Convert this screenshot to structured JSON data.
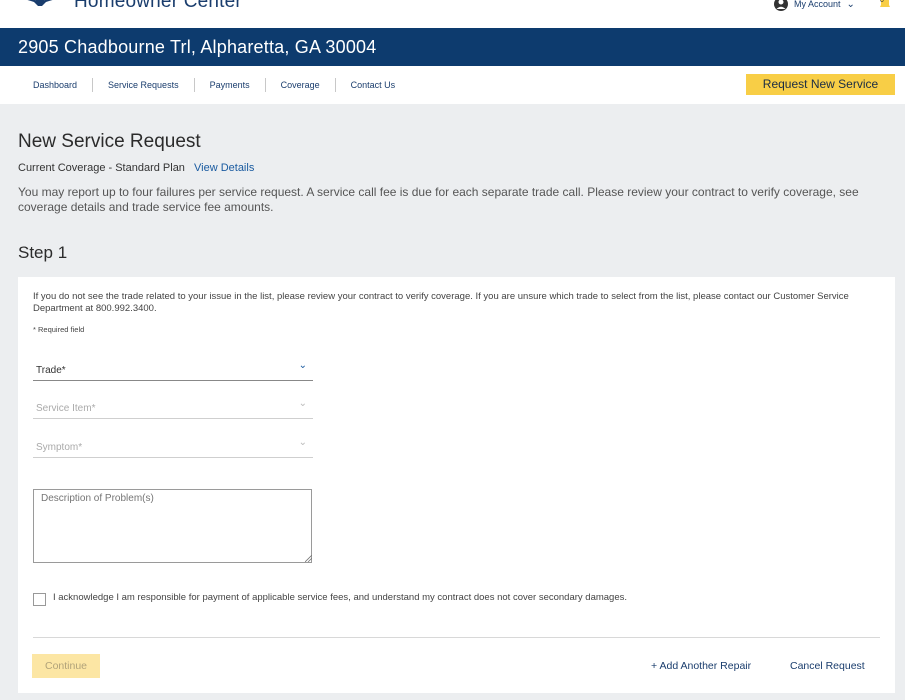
{
  "header": {
    "app_title": "Homeowner Center",
    "account_label": "My Account",
    "notification_count": "0"
  },
  "address_bar": {
    "address": "2905 Chadbourne Trl, Alpharetta, GA 30004"
  },
  "nav": {
    "items": [
      {
        "label": "Dashboard"
      },
      {
        "label": "Service Requests"
      },
      {
        "label": "Payments"
      },
      {
        "label": "Coverage"
      },
      {
        "label": "Contact Us"
      }
    ],
    "request_button": "Request New Service"
  },
  "page": {
    "title": "New Service Request",
    "coverage_text": "Current Coverage - Standard Plan",
    "view_details": "View Details",
    "intro": "You may report up to four failures per service request. A service call fee is due for each separate trade call. Please review your contract to verify coverage, see coverage details and trade service fee amounts.",
    "step_title": "Step 1"
  },
  "form": {
    "help_text": "If you do not see the trade related to your issue in the list, please review your contract to verify coverage. If you are unsure which trade to select from the list, please contact our Customer Service Department at 800.992.3400.",
    "required_note": "* Required field",
    "trade_label": "Trade*",
    "service_item_label": "Service Item*",
    "symptom_label": "Symptom*",
    "description_placeholder": "Description of Problem(s)",
    "acknowledgement": "I acknowledge I am responsible for payment of applicable service fees, and understand my contract does not cover secondary damages.",
    "continue_label": "Continue",
    "add_repair_label": "+ Add Another Repair",
    "cancel_label": "Cancel Request"
  },
  "colors": {
    "brand_navy": "#0d3b6e",
    "accent_yellow": "#f8ce46",
    "link_blue": "#1a5ba0"
  }
}
